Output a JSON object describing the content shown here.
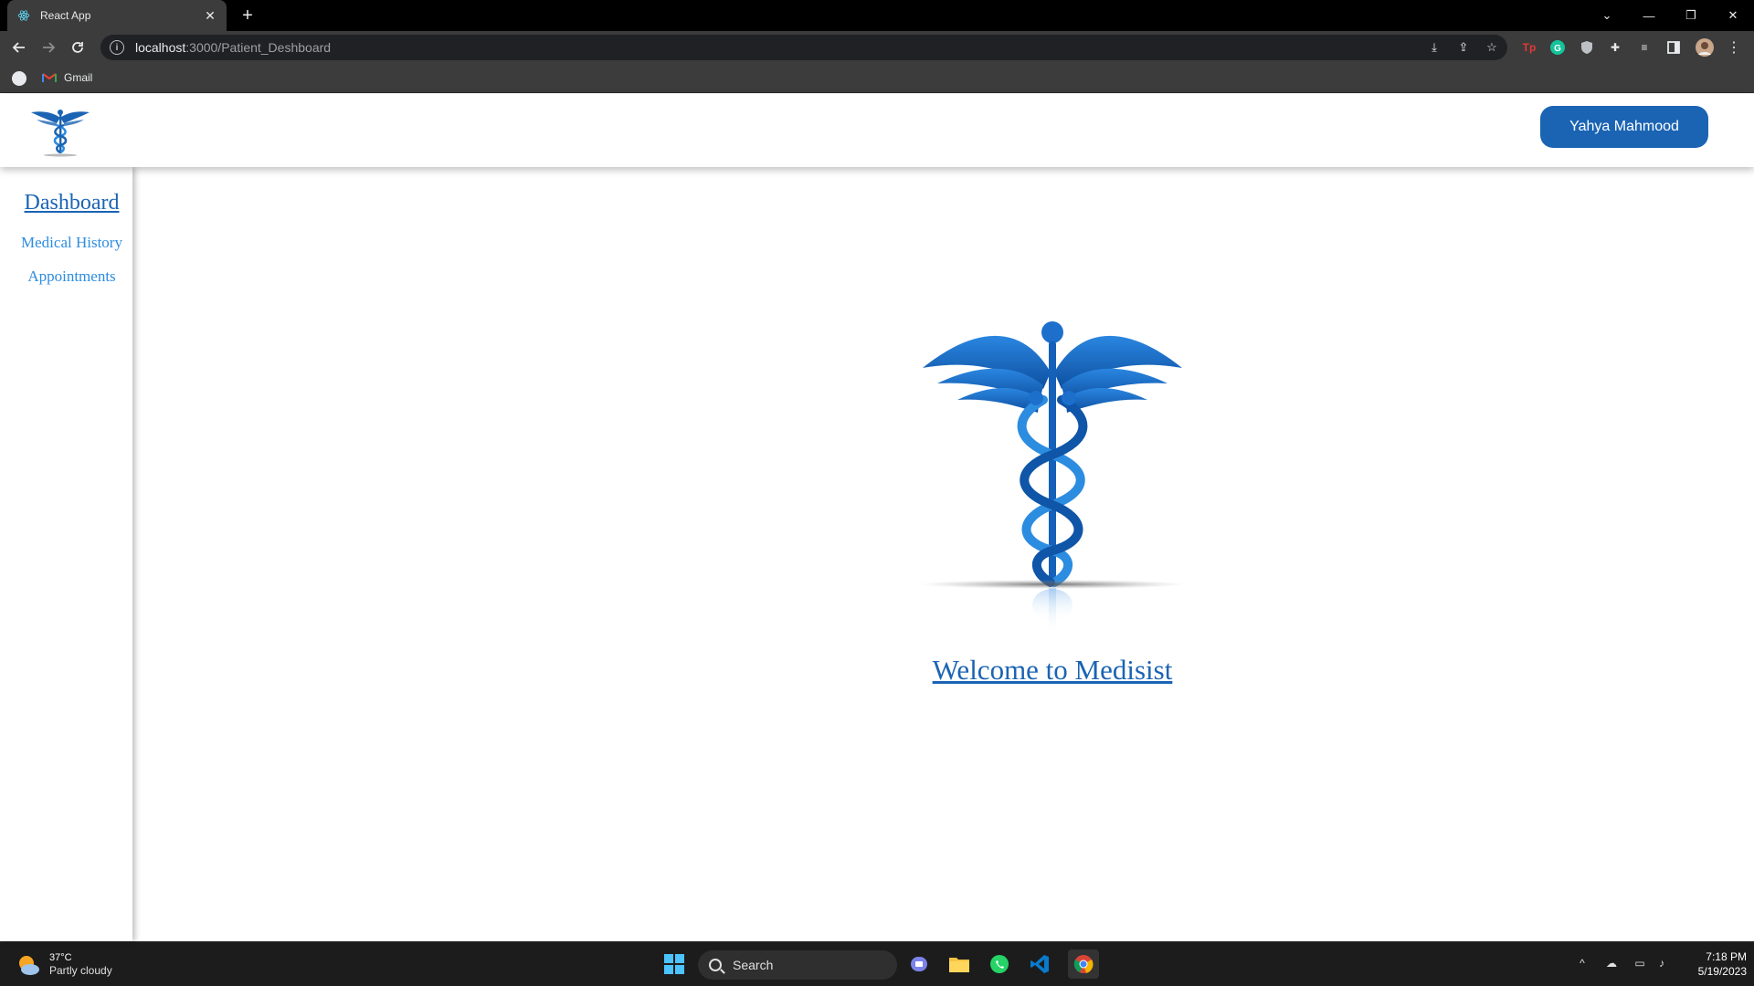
{
  "browser": {
    "tab_title": "React App",
    "url_host": "localhost",
    "url_path": ":3000/Patient_Deshboard",
    "bookmarks": [
      {
        "label": "Gmail"
      }
    ]
  },
  "header": {
    "user_button_label": "Yahya Mahmood"
  },
  "sidebar": {
    "items": [
      {
        "label": "Dashboard",
        "active": true
      },
      {
        "label": "Medical History",
        "active": false
      },
      {
        "label": "Appointments",
        "active": false
      }
    ]
  },
  "main": {
    "welcome_text": "Welcome to Medisist"
  },
  "taskbar": {
    "weather_temp": "37°C",
    "weather_desc": "Partly cloudy",
    "search_label": "Search",
    "time": "7:18 PM",
    "date": "5/19/2023"
  },
  "colors": {
    "accent": "#1b64b3",
    "link": "#2c8ce0"
  }
}
